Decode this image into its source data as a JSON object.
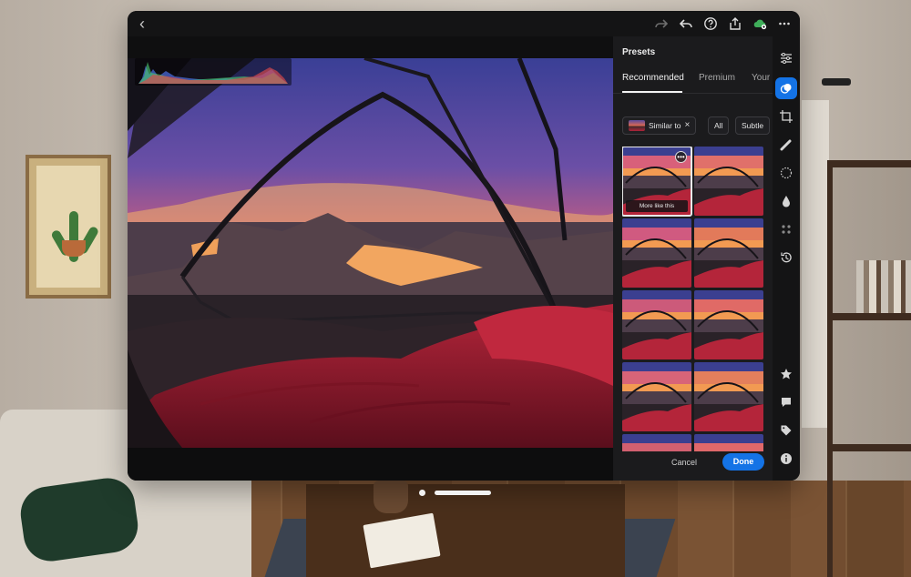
{
  "app": {
    "panel_title": "Presets",
    "tabs": [
      {
        "label": "Recommended",
        "active": true
      },
      {
        "label": "Premium",
        "active": false
      },
      {
        "label": "Your",
        "active": false
      }
    ],
    "chips": [
      {
        "label": "Similar to",
        "has_thumb": true,
        "has_close": true
      },
      {
        "label": "All"
      },
      {
        "label": "Subtle"
      }
    ],
    "chip_close_glyph": "×",
    "thumb_selected_label": "More like this",
    "thumb_more_glyph": "•••",
    "thumb_count": 10,
    "footer": {
      "cancel_label": "Cancel",
      "done_label": "Done"
    },
    "back_glyph": "‹",
    "topbar_icons": [
      "redo-icon",
      "undo-icon",
      "help-icon",
      "share-icon",
      "cloud-sync-icon",
      "more-icon"
    ],
    "rail_icons": [
      {
        "name": "sliders-icon",
        "active": false
      },
      {
        "name": "presets-icon",
        "active": true
      },
      {
        "name": "crop-icon",
        "active": false
      },
      {
        "name": "healing-brush-icon",
        "active": false
      },
      {
        "name": "masking-icon",
        "active": false
      },
      {
        "name": "color-drop-icon",
        "active": false
      },
      {
        "name": "effects-icon",
        "active": false
      },
      {
        "name": "history-icon",
        "active": false
      },
      {
        "name": "star-icon",
        "active": false
      },
      {
        "name": "comment-icon",
        "active": false
      },
      {
        "name": "tag-icon",
        "active": false
      },
      {
        "name": "info-icon",
        "active": false
      }
    ],
    "colors": {
      "accent": "#1473e6",
      "panel_bg": "#1b1b1d",
      "window_bg": "#0f0f10"
    }
  }
}
